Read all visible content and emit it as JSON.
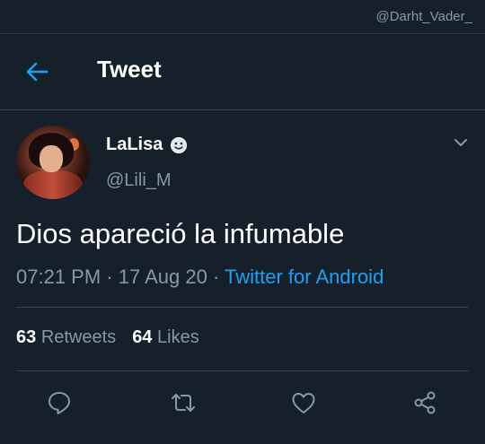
{
  "watermark": "@Darht_Vader_",
  "header": {
    "title": "Tweet"
  },
  "tweet": {
    "display_name": "LaLisa",
    "handle": "@Lili_M",
    "text": "Dios apareció la infumable",
    "time": "07:21 PM",
    "separator": " · ",
    "date": "17 Aug 20",
    "source": "Twitter for Android"
  },
  "stats": {
    "retweets_count": "63",
    "retweets_label": "Retweets",
    "likes_count": "64",
    "likes_label": "Likes"
  },
  "colors": {
    "background": "#15202b",
    "accent": "#1da1f2",
    "muted": "#8899a6",
    "divider": "#38444d"
  },
  "icons": {
    "back": "arrow-left-icon",
    "name_emoji": "smiley-emoji-icon",
    "more": "chevron-down-icon",
    "reply": "reply-icon",
    "retweet": "retweet-icon",
    "like": "heart-icon",
    "share": "share-icon"
  }
}
